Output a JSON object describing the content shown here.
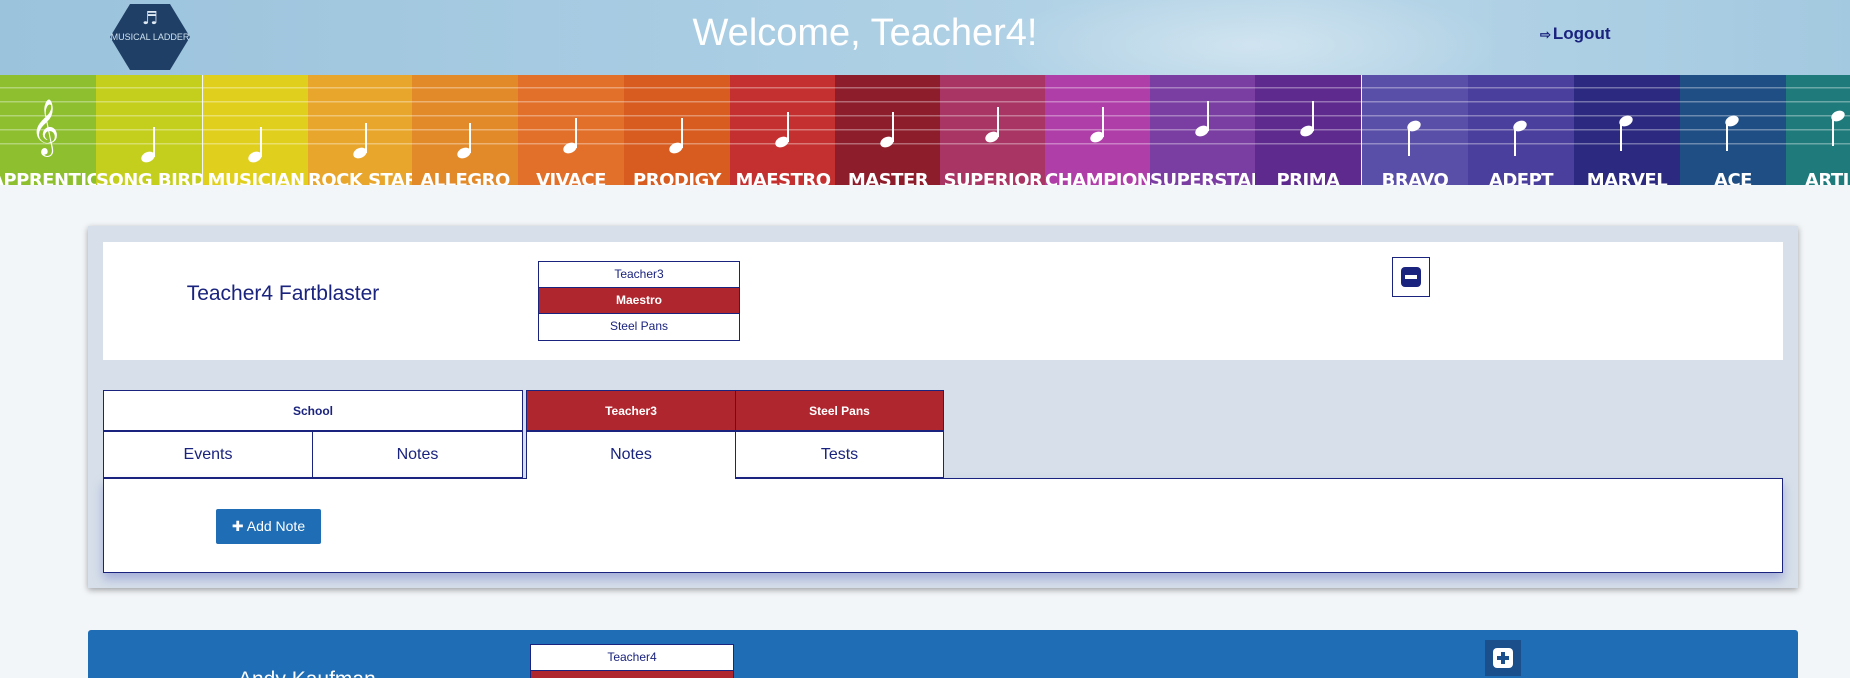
{
  "header": {
    "logo_text": "MUSICAL LADDER",
    "welcome": "Welcome, Teacher4!",
    "logout_label": "Logout"
  },
  "levels": [
    {
      "name": "APPRENTICE",
      "color": "#8dbf2e"
    },
    {
      "name": "SONG BIRD",
      "color": "#c4cf1d"
    },
    {
      "name": "MUSICIAN",
      "color": "#e0cf1c"
    },
    {
      "name": "ROCK STAR",
      "color": "#e8a62c"
    },
    {
      "name": "ALLEGRO",
      "color": "#e28a2a"
    },
    {
      "name": "VIVACE",
      "color": "#e2702a"
    },
    {
      "name": "PRODIGY",
      "color": "#d85c1f"
    },
    {
      "name": "MAESTRO",
      "color": "#c4302f"
    },
    {
      "name": "MASTER",
      "color": "#8e1d2c"
    },
    {
      "name": "SUPERIOR",
      "color": "#a83564"
    },
    {
      "name": "CHAMPION",
      "color": "#b03ea8"
    },
    {
      "name": "SUPERSTAR",
      "color": "#7a3ea2"
    },
    {
      "name": "PRIMA",
      "color": "#5e2a8e"
    },
    {
      "name": "BRAVO",
      "color": "#5a4fa8"
    },
    {
      "name": "ADEPT",
      "color": "#4a3f9c"
    },
    {
      "name": "MARVEL",
      "color": "#2b2a80"
    },
    {
      "name": "ACE",
      "color": "#1f4e84"
    },
    {
      "name": "ARTIST",
      "color": "#1f7a7c"
    }
  ],
  "student1": {
    "name": "Teacher4 Fartblaster",
    "teacher": "Teacher3",
    "level": "Maestro",
    "instrument": "Steel Pans",
    "school_header": "School",
    "teacher_header": "Teacher3",
    "instrument_header": "Steel Pans",
    "tabs": [
      "Events",
      "Notes",
      "Notes",
      "Tests"
    ],
    "add_note_label": "Add Note"
  },
  "student2": {
    "name": "Andy Kaufman",
    "teacher": "Teacher4"
  }
}
